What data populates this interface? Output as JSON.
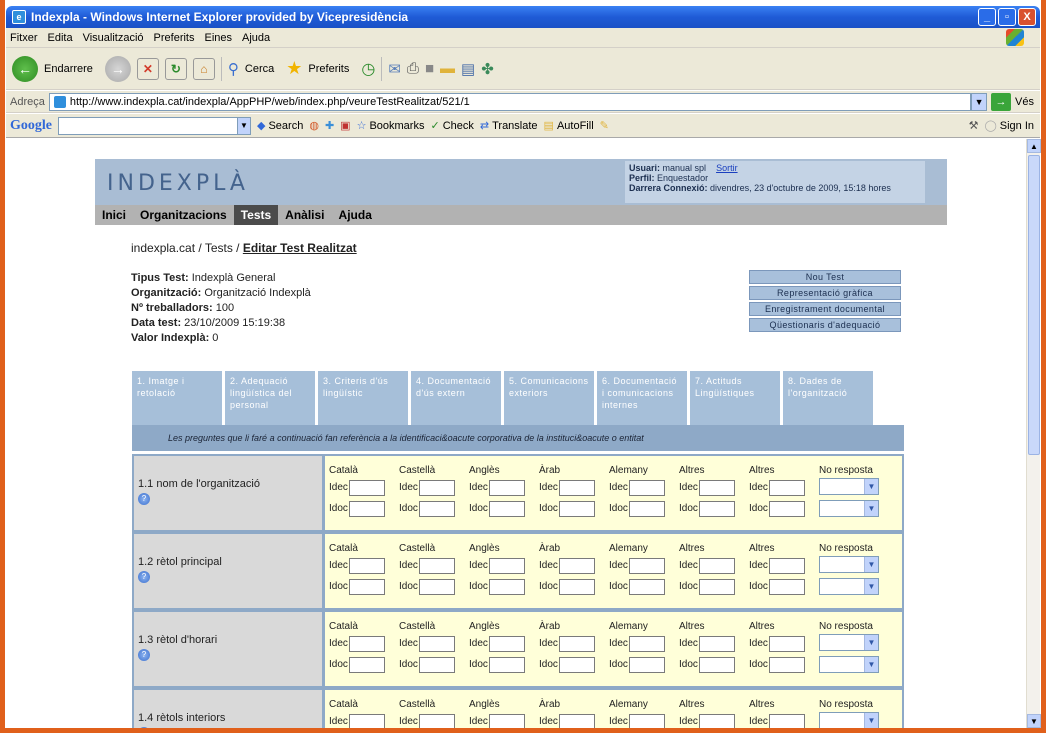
{
  "window": {
    "title": "Indexpla - Windows Internet Explorer provided by Vicepresidència",
    "buttons": [
      "_",
      "▫",
      "X"
    ]
  },
  "menu": [
    "Fitxer",
    "Edita",
    "Visualització",
    "Preferits",
    "Eines",
    "Ajuda"
  ],
  "toolbar": {
    "back_label": "Endarrere",
    "search_label": "Cerca",
    "favorites_label": "Preferits"
  },
  "address": {
    "label": "Adreça",
    "url": "http://www.indexpla.cat/indexpla/AppPHP/web/index.php/veureTestRealitzat/521/1",
    "go_label": "Vés"
  },
  "google_bar": {
    "logo": "Google",
    "items": [
      "Search",
      "Bookmarks",
      "Check",
      "Translate",
      "AutoFill"
    ],
    "sign_in": "Sign In"
  },
  "page": {
    "logo": "INDEXPLÀ",
    "user": {
      "usuari_label": "Usuari:",
      "usuari": "manual spl",
      "sortir": "Sortir",
      "perfil_label": "Perfil:",
      "perfil": "Enquestador",
      "connexio_label": "Darrera Connexió:",
      "connexio": "divendres, 23 d'octubre de 2009, 15:18 hores"
    },
    "nav": [
      "Inici",
      "Organitzacions",
      "Tests",
      "Anàlisi",
      "Ajuda"
    ],
    "breadcrumb": {
      "root": "indexpla.cat / Tests / ",
      "current": "Editar Test Realitzat"
    },
    "info": [
      {
        "label": "Tipus Test:",
        "value": " Indexplà General"
      },
      {
        "label": "Organització:",
        "value": " Organització Indexplà"
      },
      {
        "label": "Nº treballadors:",
        "value": " 100"
      },
      {
        "label": "Data test:",
        "value": " 23/10/2009 15:19:38"
      },
      {
        "label": "Valor Indexplà:",
        "value": " 0"
      }
    ],
    "side_buttons": [
      "Nou Test",
      "Representació gràfica",
      "Enregistrament documental",
      "Qüestionaris d'adequació"
    ],
    "tabs": [
      "1. Imatge i retolació",
      "2. Adequació lingüística del personal",
      "3. Criteris d'ús lingüístic",
      "4. Documentació d'ús extern",
      "5. Comunicacions exteriors",
      "6. Documentació i comunicacions internes",
      "7. Actituds Lingüístiques",
      "8. Dades de l'organització"
    ],
    "intro": "Les preguntes que li faré a continuació fan referència a la identificaci&oacute corporativa de la instituci&oacute o entitat",
    "languages": [
      "Català",
      "Castellà",
      "Anglès",
      "Àrab",
      "Alemany",
      "Altres",
      "Altres"
    ],
    "no_resposta": "No resposta",
    "idec": "Idec",
    "idoc": "Idoc",
    "questions": [
      "1.1 nom de l'organització",
      "1.2 rètol principal",
      "1.3 rètol d'horari",
      "1.4 rètols interiors"
    ]
  }
}
